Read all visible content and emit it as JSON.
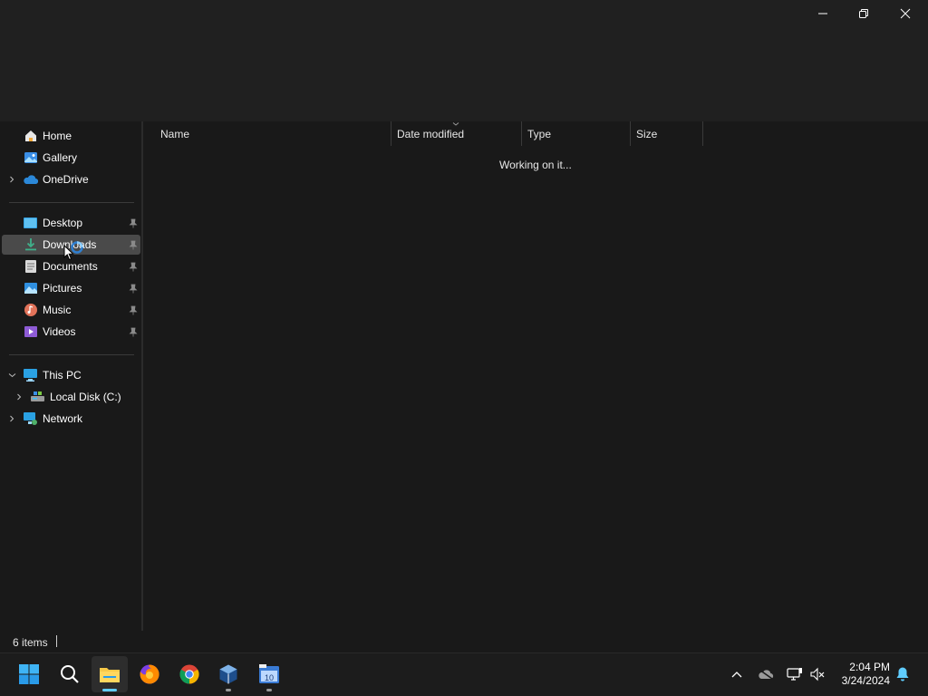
{
  "window": {
    "minimize_icon": "minimize-icon",
    "restore_icon": "restore-icon",
    "close_icon": "close-icon"
  },
  "sidebar": {
    "items": [
      {
        "label": "Home",
        "icon": "home-icon"
      },
      {
        "label": "Gallery",
        "icon": "gallery-icon"
      },
      {
        "label": "OneDrive",
        "icon": "onedrive-icon"
      },
      {
        "label": "Desktop",
        "icon": "desktop-icon",
        "pinned": true
      },
      {
        "label": "Downloads",
        "icon": "downloads-icon",
        "pinned": true,
        "selected": true
      },
      {
        "label": "Documents",
        "icon": "documents-icon",
        "pinned": true
      },
      {
        "label": "Pictures",
        "icon": "pictures-icon",
        "pinned": true
      },
      {
        "label": "Music",
        "icon": "music-icon",
        "pinned": true
      },
      {
        "label": "Videos",
        "icon": "videos-icon",
        "pinned": true
      },
      {
        "label": "This PC",
        "icon": "this-pc-icon"
      },
      {
        "label": "Local Disk (C:)",
        "icon": "local-disk-icon"
      },
      {
        "label": "Network",
        "icon": "network-icon"
      }
    ]
  },
  "content": {
    "columns": [
      "Name",
      "Date modified",
      "Type",
      "Size"
    ],
    "sort_column": "Date modified",
    "loading_text": "Working on it..."
  },
  "status": {
    "item_count": "6 items"
  },
  "taskbar": {
    "apps": [
      "start-icon",
      "search-icon",
      "file-explorer-icon",
      "firefox-icon",
      "chrome-icon",
      "virtualbox-icon",
      "app-10-icon"
    ],
    "tray": [
      "chevron-up-icon",
      "onedrive-offline-icon",
      "network-display-icon",
      "volume-muted-icon",
      "notification-bell-icon"
    ],
    "time": "2:04 PM",
    "date": "3/24/2024"
  },
  "colors": {
    "accent": "#60cdff",
    "selected_bg": "#4a4a4a",
    "window_bg": "#191919",
    "titlebar_bg": "#202020"
  }
}
